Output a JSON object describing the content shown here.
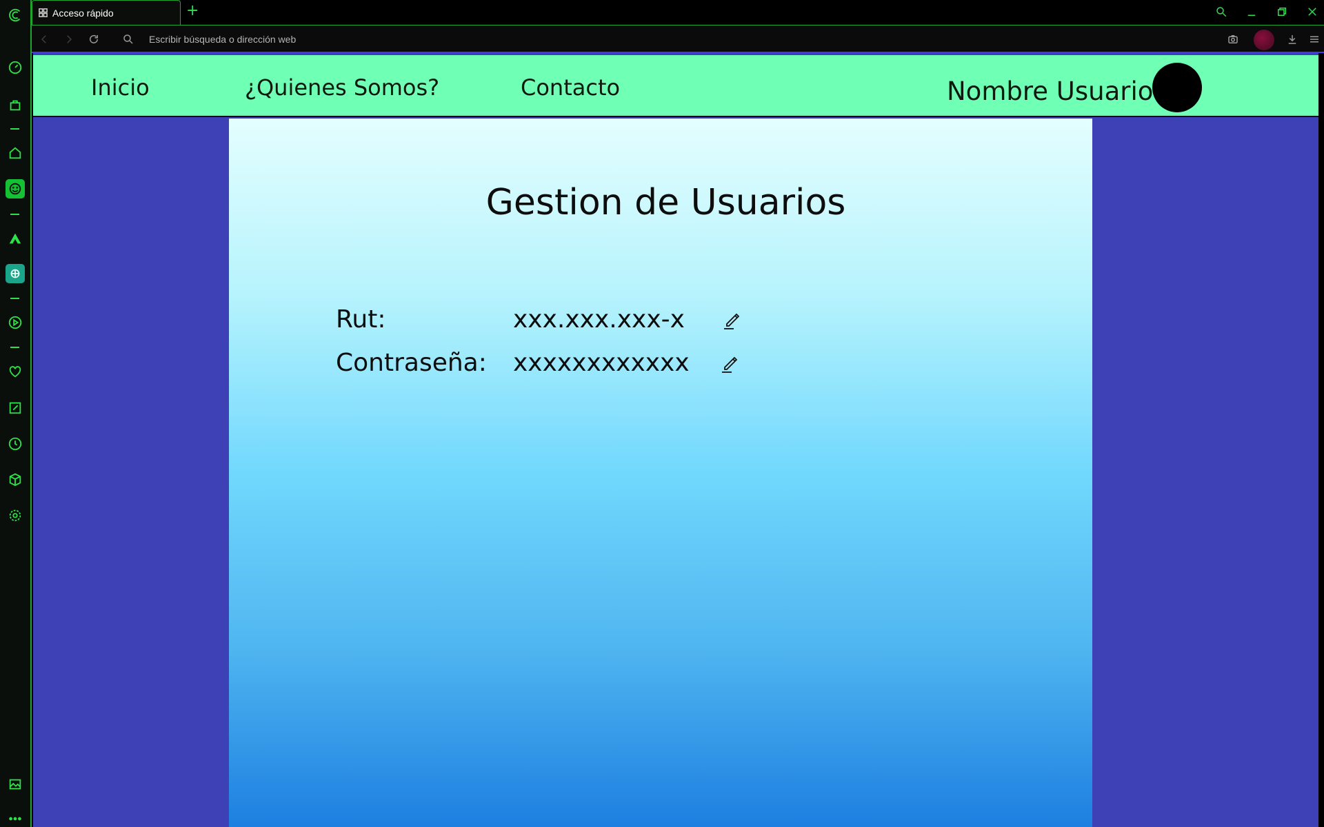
{
  "browser": {
    "tab_title": "Acceso rápido",
    "new_tab_label": "+",
    "address_placeholder": "Escribir búsqueda o dirección web"
  },
  "sidebar_icons": [
    "opera-logo-icon",
    "speed-dial-icon",
    "shopping-bag-icon",
    "home-icon",
    "emoji-icon",
    "aria-icon",
    "chatgpt-icon",
    "player-icon",
    "heart-icon",
    "edit-icon",
    "history-icon",
    "cube-icon",
    "settings-icon",
    "gallery-icon",
    "more-icon"
  ],
  "nav": {
    "links": [
      "Inicio",
      "¿Quienes Somos?",
      "Contacto"
    ],
    "user_name": "Nombre Usuario"
  },
  "main": {
    "title": "Gestion de Usuarios",
    "fields": [
      {
        "label": "Rut:",
        "value": "xxx.xxx.xxx-x"
      },
      {
        "label": "Contraseña:",
        "value": "xxxxxxxxxxxx"
      }
    ]
  },
  "colors": {
    "nav_bg": "#6fffb5",
    "page_bg": "#3e40b5",
    "chrome_accent": "#2ee04a"
  }
}
